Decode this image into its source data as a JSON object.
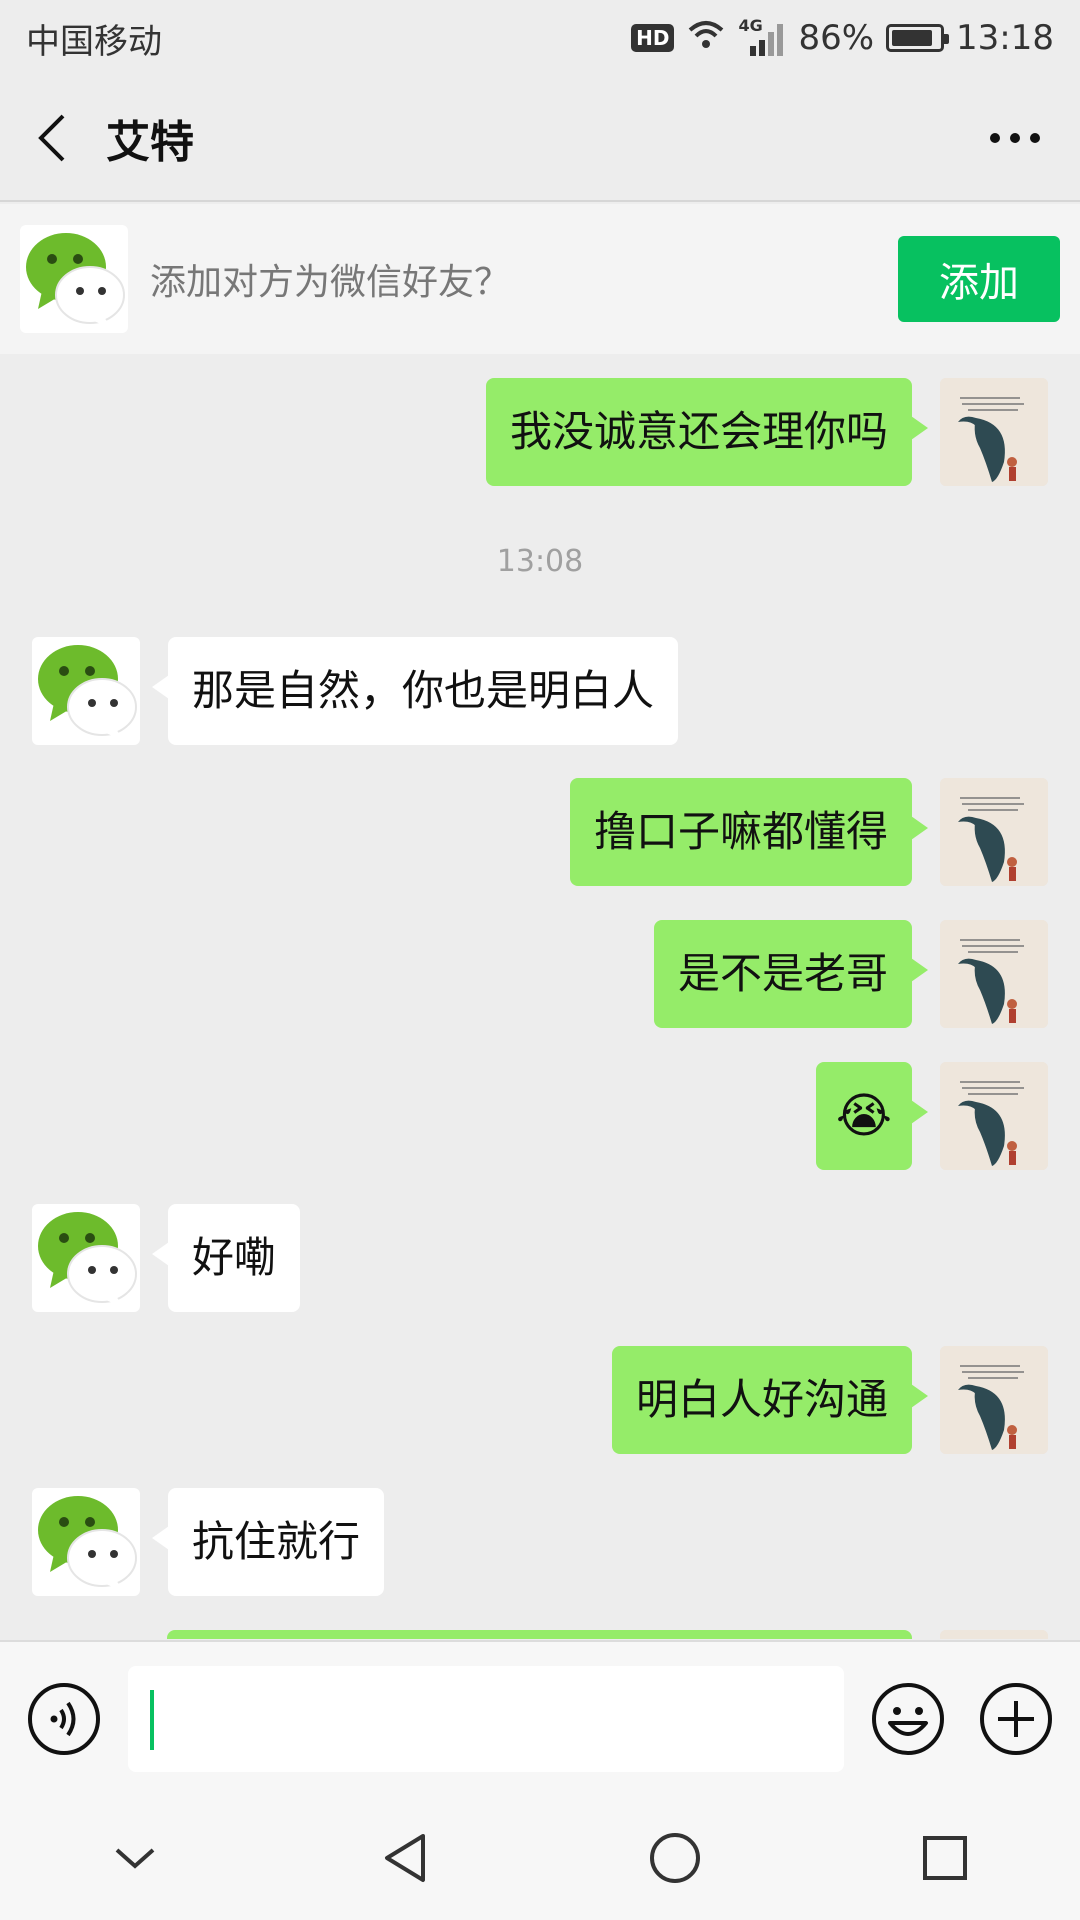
{
  "status_bar": {
    "carrier": "中国移动",
    "hd": "HD",
    "network": "4G",
    "battery_percent": "86%",
    "battery_level": 0.86,
    "time": "13:18"
  },
  "header": {
    "title": "艾特"
  },
  "banner": {
    "text": "添加对方为微信好友？",
    "button_label": "添加"
  },
  "colors": {
    "accent": "#07c160",
    "sent_bubble": "#95ec69",
    "received_bubble": "#ffffff",
    "background": "#ededed"
  },
  "messages": [
    {
      "side": "right",
      "text": "我没诚意还会理你吗"
    },
    {
      "type": "timestamp",
      "text": "13:08"
    },
    {
      "side": "left",
      "text": "那是自然，你也是明白人"
    },
    {
      "side": "right",
      "text": "撸口子嘛都懂得"
    },
    {
      "side": "right",
      "text": "是不是老哥"
    },
    {
      "side": "right",
      "emoji": "😭"
    },
    {
      "side": "left",
      "text": "好嘞"
    },
    {
      "side": "right",
      "text": "明白人好沟通"
    },
    {
      "side": "left",
      "text": "抗住就行"
    }
  ],
  "input": {
    "value": ""
  },
  "icons": {
    "back": "back-arrow-icon",
    "more": "more-dots-icon",
    "voice": "voice-icon",
    "emoji": "emoji-icon",
    "plus": "plus-icon",
    "nav_down": "chevron-down-icon",
    "nav_back": "nav-back-icon",
    "nav_home": "nav-home-icon",
    "nav_recent": "nav-recent-icon"
  }
}
